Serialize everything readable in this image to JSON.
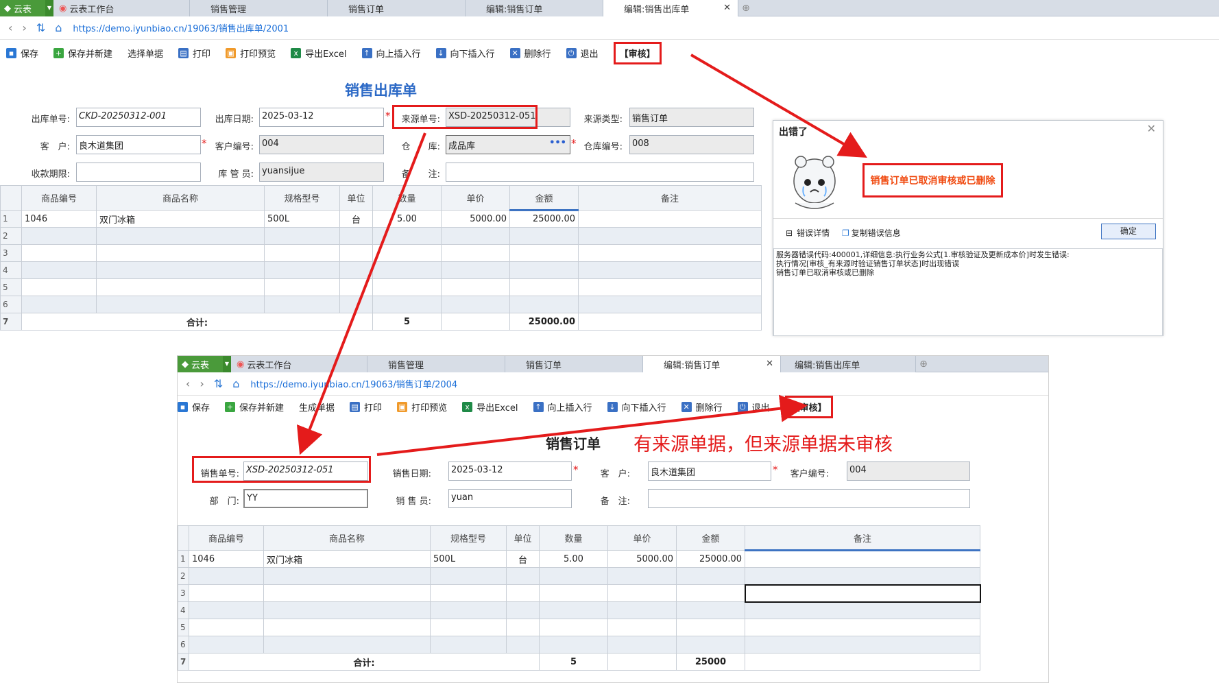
{
  "top": {
    "app_name": "云表",
    "tabs": [
      {
        "label": "云表工作台"
      },
      {
        "label": "销售管理"
      },
      {
        "label": "销售订单"
      },
      {
        "label": "编辑:销售订单"
      },
      {
        "label": "编辑:销售出库单"
      }
    ],
    "url": "https://demo.iyunbiao.cn/19063/销售出库单/2001",
    "toolbar": {
      "save": "保存",
      "save_new": "保存并新建",
      "select_doc": "选择单据",
      "print": "打印",
      "print_preview": "打印预览",
      "export_excel": "导出Excel",
      "insert_up": "向上插入行",
      "insert_down": "向下插入行",
      "delete_row": "删除行",
      "exit": "退出",
      "review": "【审核】"
    },
    "form_title": "销售出库单",
    "labels": {
      "out_no": "出库单号:",
      "out_date": "出库日期:",
      "source_no": "来源单号:",
      "source_type": "来源类型:",
      "customer": "客　户:",
      "customer_no": "客户编号:",
      "warehouse": "仓　　库:",
      "warehouse_no": "仓库编号:",
      "collect_term": "收款期限:",
      "keeper": "库 管 员:",
      "remark": "备　　注:"
    },
    "values": {
      "out_no": "CKD-20250312-001",
      "out_date": "2025-03-12",
      "source_no": "XSD-20250312-051",
      "source_type": "销售订单",
      "customer": "良木道集团",
      "customer_no": "004",
      "warehouse": "成品库",
      "warehouse_more": "•••",
      "warehouse_no": "008",
      "collect_term": "",
      "keeper": "yuansijue",
      "remark": ""
    },
    "columns": [
      "商品编号",
      "商品名称",
      "规格型号",
      "单位",
      "数量",
      "单价",
      "金额",
      "备注"
    ],
    "rows": [
      {
        "n": "1",
        "code": "1046",
        "name": "双门冰箱",
        "spec": "500L",
        "unit": "台",
        "qty": "5.00",
        "price": "5000.00",
        "amount": "25000.00",
        "note": ""
      },
      {
        "n": "2"
      },
      {
        "n": "3"
      },
      {
        "n": "4"
      },
      {
        "n": "5"
      },
      {
        "n": "6"
      }
    ],
    "total": {
      "n": "7",
      "label": "合计:",
      "qty": "5",
      "amount": "25000.00"
    }
  },
  "dialog": {
    "title": "出错了",
    "message": "销售订单已取消审核或已删除",
    "detail_toggle": "错误详情",
    "copy": "复制错误信息",
    "ok": "确定",
    "log": "服务器错误代码:400001,详细信息:执行业务公式[1.审核验证及更新成本价]时发生错误:\n执行情况[审核_有来源时验证销售订单状态]时出现错误\n销售订单已取消审核或已删除"
  },
  "bottom": {
    "app_name": "云表",
    "tabs": [
      {
        "label": "云表工作台"
      },
      {
        "label": "销售管理"
      },
      {
        "label": "销售订单"
      },
      {
        "label": "编辑:销售订单"
      },
      {
        "label": "编辑:销售出库单"
      }
    ],
    "url": "https://demo.iyunbiao.cn/19063/销售订单/2004",
    "toolbar": {
      "save": "保存",
      "save_new": "保存并新建",
      "gen_doc": "生成单据",
      "print": "打印",
      "print_preview": "打印预览",
      "export_excel": "导出Excel",
      "insert_up": "向上插入行",
      "insert_down": "向下插入行",
      "delete_row": "删除行",
      "exit": "退出",
      "review": "【审核】"
    },
    "form_title": "销售订单",
    "labels": {
      "order_no": "销售单号:",
      "order_date": "销售日期:",
      "customer": "客　户:",
      "customer_no": "客户编号:",
      "dept": "部　门:",
      "seller": "销 售 员:",
      "remark": "备　注:"
    },
    "values": {
      "order_no": "XSD-20250312-051",
      "order_date": "2025-03-12",
      "customer": "良木道集团",
      "customer_no": "004",
      "dept": "YY",
      "seller": "yuan",
      "remark": ""
    },
    "columns": [
      "商品编号",
      "商品名称",
      "规格型号",
      "单位",
      "数量",
      "单价",
      "金额",
      "备注"
    ],
    "rows": [
      {
        "n": "1",
        "code": "1046",
        "name": "双门冰箱",
        "spec": "500L",
        "unit": "台",
        "qty": "5.00",
        "price": "5000.00",
        "amount": "25000.00",
        "note": ""
      },
      {
        "n": "2"
      },
      {
        "n": "3"
      },
      {
        "n": "4"
      },
      {
        "n": "5"
      },
      {
        "n": "6"
      }
    ],
    "total": {
      "n": "7",
      "label": "合计:",
      "qty": "5",
      "amount": "25000"
    }
  },
  "annotation": "有来源单据，但来源单据未审核",
  "colors": {
    "accent": "#2b69c6",
    "highlight": "#e41b1b",
    "app_green": "#4a9a3a"
  }
}
